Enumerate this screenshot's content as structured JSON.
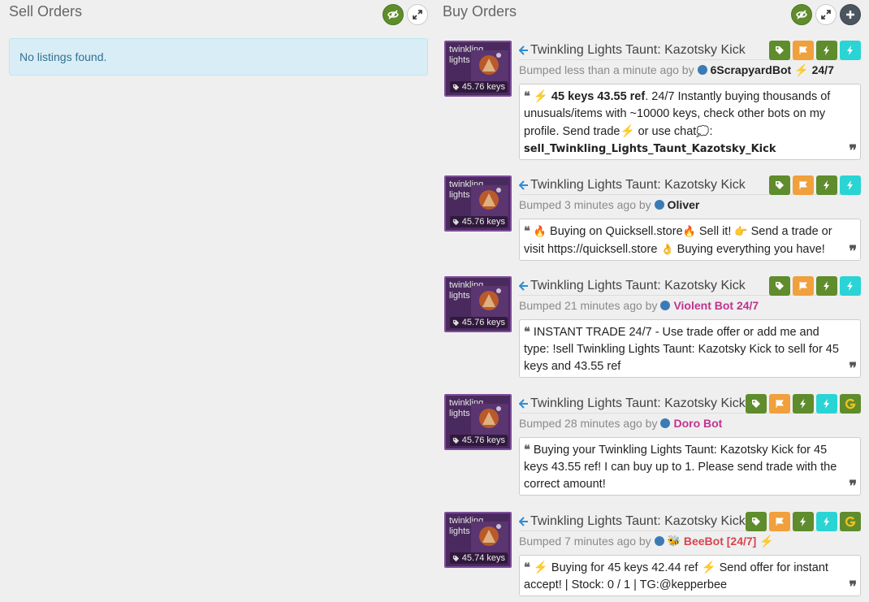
{
  "sell": {
    "title": "Sell Orders",
    "empty_message": "No listings found."
  },
  "buy": {
    "title": "Buy Orders",
    "listings": [
      {
        "item_name": "twinkling lights",
        "price": "45.76 keys",
        "title": "Twinkling Lights Taunt: Kazotsky Kick",
        "bumped_prefix": "Bumped less than a minute ago by",
        "user": "6ScrapyardBot",
        "user_suffix": "24/7",
        "comment_price": "45 keys 43.55 ref",
        "comment_body": ". 24/7 Instantly buying thousands of unusuals/items with ~10000 keys, check other bots on my profile. Send  trade",
        "comment_mid": "or  use  chat",
        "comment_cmd": "sell_Twinkling_Lights_Taunt_Kazotsky_Kick"
      },
      {
        "item_name": "twinkling lights",
        "price": "45.76 keys",
        "title": "Twinkling Lights Taunt: Kazotsky Kick",
        "bumped_prefix": "Bumped 3 minutes ago by",
        "user": "Oliver",
        "comment_a": "Buying on Quicksell.store",
        "comment_b": "Sell it!",
        "comment_c": "Send a trade or visit https://quicksell.store",
        "comment_d": "Buying everything you have!"
      },
      {
        "item_name": "twinkling lights",
        "price": "45.76 keys",
        "title": "Twinkling Lights Taunt: Kazotsky Kick",
        "bumped_prefix": "Bumped 21 minutes ago by",
        "user": "Violent Bot 24/7",
        "comment": "INSTANT TRADE 24/7 - Use trade offer or add me and type: !sell Twinkling Lights Taunt: Kazotsky Kick to sell for 45 keys and 43.55 ref"
      },
      {
        "item_name": "twinkling lights",
        "price": "45.76 keys",
        "title": "Twinkling Lights Taunt: Kazotsky Kick",
        "bumped_prefix": "Bumped 28 minutes ago by",
        "user": "Doro Bot",
        "comment": "Buying your Twinkling Lights Taunt: Kazotsky Kick for 45 keys 43.55 ref! I can buy up to 1. Please send trade with the correct amount!"
      },
      {
        "item_name": "twinkling lights",
        "price": "45.74 keys",
        "title": "Twinkling Lights Taunt: Kazotsky Kick",
        "bumped_prefix": "Bumped 7 minutes ago by",
        "user": "BeeBot [24/7]",
        "comment_a": "Buying for 45 keys 42.44 ref",
        "comment_b": "Send offer for instant accept! | Stock: 0 / 1 | TG:@kepperbee"
      }
    ]
  },
  "colors": {
    "accent_green": "#5f8c2c",
    "accent_orange": "#f0a03c",
    "accent_cyan": "#2ad4d4",
    "info_bg": "#d9edf7",
    "item_purple": "#4a2a5e"
  },
  "icons": {
    "visibility": "eye-slash-icon",
    "expand": "expand-icon",
    "add": "plus-icon",
    "tag": "tag-icon",
    "flag": "flag-icon",
    "bolt": "bolt-icon",
    "arrow": "arrow-left-icon",
    "quote": "quote-icon"
  }
}
